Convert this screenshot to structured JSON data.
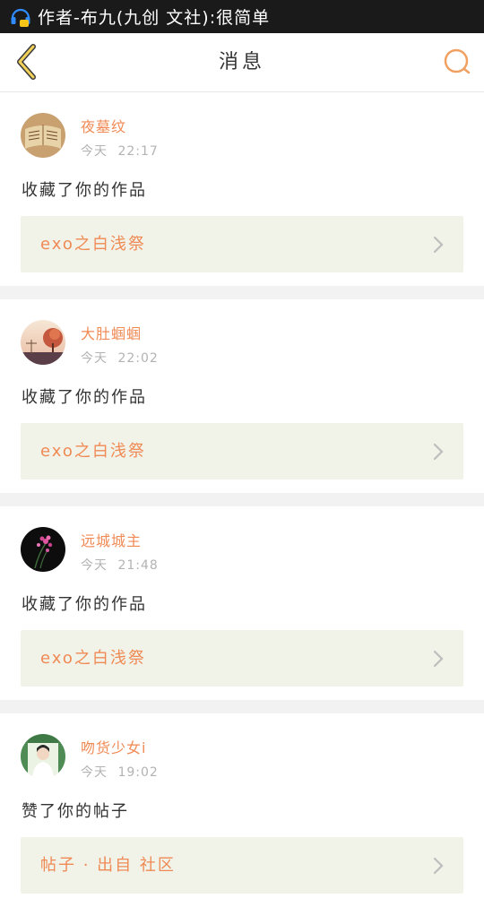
{
  "status_bar": {
    "notification_text": "作者-布九(九创 文社):很简单",
    "icon": "headset-notification-icon"
  },
  "header": {
    "title": "消息",
    "back_icon": "chevron-left-icon",
    "search_icon": "search-icon",
    "accent_color": "#f0a060"
  },
  "notifications": [
    {
      "username": "夜墓纹",
      "time": "今天 22:17",
      "action": "收藏了你的作品",
      "work": "exo之白浅祭",
      "avatar": "open-book-avatar"
    },
    {
      "username": "大肚蝈蝈",
      "time": "今天 22:02",
      "action": "收藏了你的作品",
      "work": "exo之白浅祭",
      "avatar": "sunset-scene-avatar"
    },
    {
      "username": "远城城主",
      "time": "今天 21:48",
      "action": "收藏了你的作品",
      "work": "exo之白浅祭",
      "avatar": "pink-flower-avatar"
    },
    {
      "username": "吻货少女i",
      "time": "今天 19:02",
      "action": "赞了你的帖子",
      "work": "帖子 · 出自 社区",
      "avatar": "person-portrait-avatar"
    }
  ],
  "colors": {
    "username": "#f08a55",
    "timestamp": "#b3b3b3",
    "link_background": "#f1f3e9",
    "separator": "#f2f2f2"
  }
}
